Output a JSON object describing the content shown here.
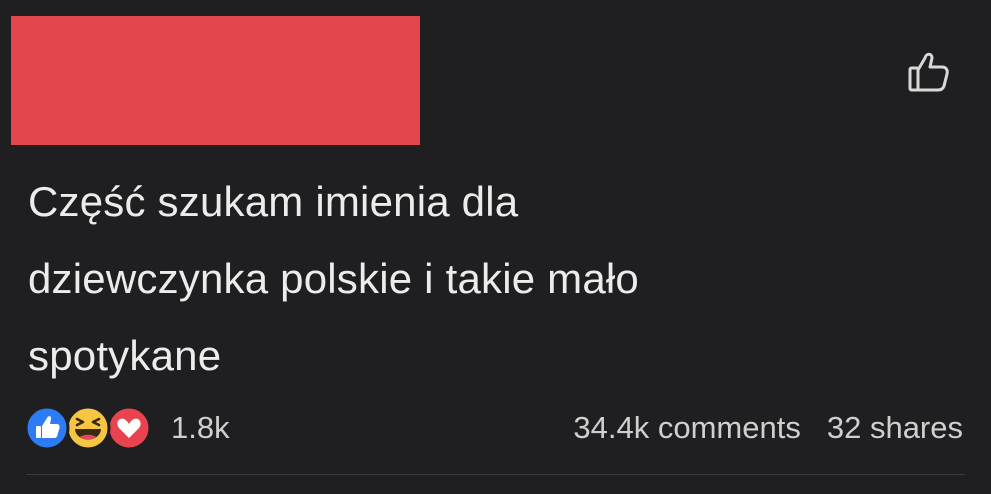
{
  "post": {
    "text_lines": [
      "Część szukam imienia dla",
      "dziewczynka polskie i takie mało",
      "spotykane"
    ],
    "reaction_count": "1.8k",
    "comments": "34.4k comments",
    "shares": "32 shares",
    "reactions": [
      "like-icon",
      "haha-icon",
      "love-icon"
    ],
    "colors": {
      "background": "#1f1f21",
      "redaction": "#e5464e",
      "like": "#2d7cf6",
      "haha": "#f6c544",
      "love": "#e9434f"
    }
  }
}
